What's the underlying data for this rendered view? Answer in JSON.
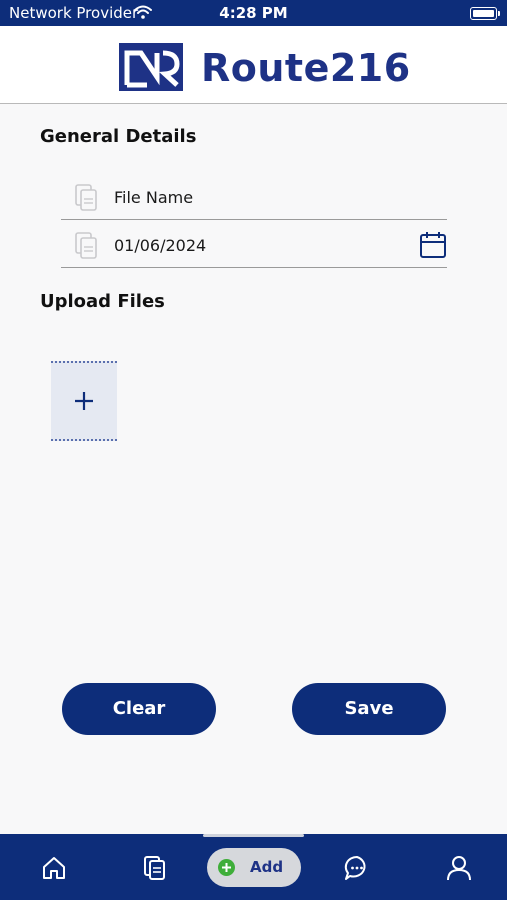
{
  "status_bar": {
    "carrier": "Network Provider",
    "time": "4:28 PM"
  },
  "header": {
    "brand": "Route216"
  },
  "general_details": {
    "title": "General Details",
    "file_name_value": "File Name",
    "date_value": "01/06/2024"
  },
  "upload": {
    "title": "Upload Files"
  },
  "actions": {
    "clear_label": "Clear",
    "save_label": "Save"
  },
  "tabbar": {
    "add_label": "Add",
    "items": [
      "home-icon",
      "documents-icon",
      "add-icon",
      "chat-icon",
      "profile-icon"
    ]
  },
  "colors": {
    "primary": "#0d2d7a",
    "brand_text": "#1e3286",
    "add_green": "#3fae3a",
    "background": "#f8f8f9"
  }
}
